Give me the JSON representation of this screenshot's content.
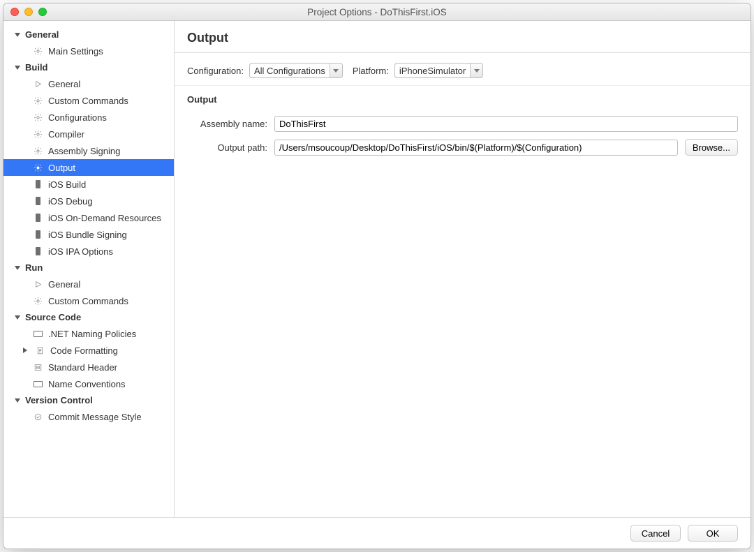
{
  "window": {
    "title": "Project Options - DoThisFirst.iOS"
  },
  "sidebar": {
    "general": {
      "label": "General",
      "items": [
        {
          "label": "Main Settings",
          "icon": "gear"
        }
      ]
    },
    "build": {
      "label": "Build",
      "items": [
        {
          "label": "General",
          "icon": "play"
        },
        {
          "label": "Custom Commands",
          "icon": "gear"
        },
        {
          "label": "Configurations",
          "icon": "gear"
        },
        {
          "label": "Compiler",
          "icon": "gear"
        },
        {
          "label": "Assembly Signing",
          "icon": "gear"
        },
        {
          "label": "Output",
          "icon": "gear",
          "selected": true
        },
        {
          "label": "iOS Build",
          "icon": "phone"
        },
        {
          "label": "iOS Debug",
          "icon": "phone"
        },
        {
          "label": "iOS On-Demand Resources",
          "icon": "phone"
        },
        {
          "label": "iOS Bundle Signing",
          "icon": "phone"
        },
        {
          "label": "iOS IPA Options",
          "icon": "phone"
        }
      ]
    },
    "run": {
      "label": "Run",
      "items": [
        {
          "label": "General",
          "icon": "play"
        },
        {
          "label": "Custom Commands",
          "icon": "gear"
        }
      ]
    },
    "sourcecode": {
      "label": "Source Code",
      "items": [
        {
          "label": ".NET Naming Policies",
          "icon": "kb"
        },
        {
          "label": "Code Formatting",
          "icon": "doc",
          "expandable": true
        },
        {
          "label": "Standard Header",
          "icon": "hash"
        },
        {
          "label": "Name Conventions",
          "icon": "kb"
        }
      ]
    },
    "versioncontrol": {
      "label": "Version Control",
      "items": [
        {
          "label": "Commit Message Style",
          "icon": "check"
        }
      ]
    }
  },
  "main": {
    "title": "Output",
    "config_label": "Configuration:",
    "config_value": "All Configurations",
    "platform_label": "Platform:",
    "platform_value": "iPhoneSimulator",
    "section": "Output",
    "assembly_label": "Assembly name:",
    "assembly_value": "DoThisFirst",
    "outputpath_label": "Output path:",
    "outputpath_value": "/Users/msoucoup/Desktop/DoThisFirst/iOS/bin/$(Platform)/$(Configuration)",
    "browse": "Browse..."
  },
  "footer": {
    "cancel": "Cancel",
    "ok": "OK"
  }
}
